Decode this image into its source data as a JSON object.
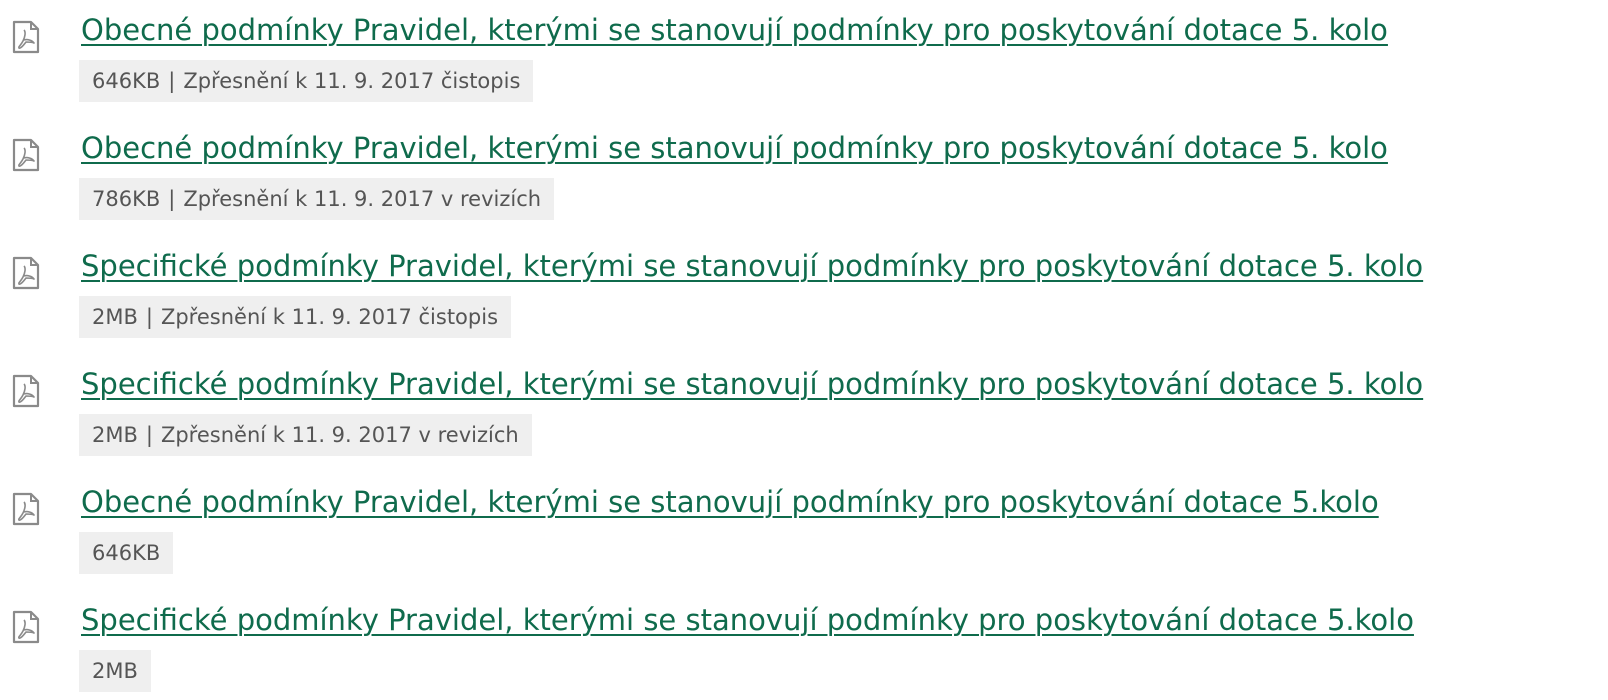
{
  "documents": [
    {
      "title": "Obecné podmínky Pravidel, kterými se stanovují podmínky pro poskytování dotace 5. kolo",
      "size": "646KB",
      "separator": "|",
      "note": "Zpřesnění k 11. 9. 2017 čistopis",
      "icon": "pdf-file-icon"
    },
    {
      "title": "Obecné podmínky Pravidel, kterými se stanovují podmínky pro poskytování dotace 5. kolo",
      "size": "786KB",
      "separator": "|",
      "note": "Zpřesnění k 11. 9. 2017 v revizích",
      "icon": "pdf-file-icon"
    },
    {
      "title": "Specifické podmínky Pravidel, kterými se stanovují podmínky pro poskytování dotace 5. kolo",
      "size": "2MB",
      "separator": "|",
      "note": "Zpřesnění k 11. 9. 2017 čistopis",
      "icon": "pdf-file-icon"
    },
    {
      "title": "Specifické podmínky Pravidel, kterými se stanovují podmínky pro poskytování dotace 5. kolo",
      "size": "2MB",
      "separator": "|",
      "note": "Zpřesnění k 11. 9. 2017 v revizích",
      "icon": "pdf-file-icon"
    },
    {
      "title": "Obecné podmínky Pravidel, kterými se stanovují podmínky pro poskytování dotace 5.kolo",
      "size": "646KB",
      "icon": "pdf-file-icon"
    },
    {
      "title": "Specifické podmínky Pravidel, kterými se stanovují podmínky pro poskytování dotace 5.kolo",
      "size": "2MB",
      "icon": "pdf-file-icon"
    }
  ],
  "colors": {
    "link": "#0f6b4c",
    "meta_background": "#efefef",
    "meta_text": "#555555",
    "icon_stroke": "#8a8a8a"
  }
}
